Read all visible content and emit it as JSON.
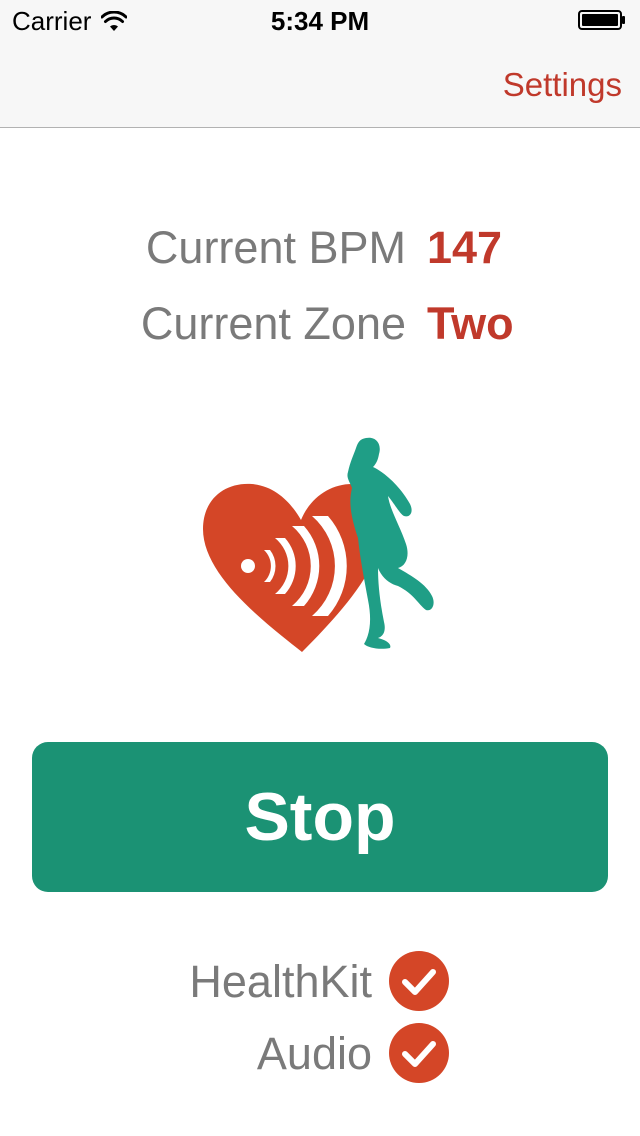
{
  "status_bar": {
    "carrier": "Carrier",
    "time": "5:34 PM",
    "wifi_icon": "wifi-icon",
    "battery_icon": "battery-icon"
  },
  "nav": {
    "settings_label": "Settings"
  },
  "stats": {
    "bpm_label": "Current BPM",
    "bpm_value": "147",
    "zone_label": "Current Zone",
    "zone_value": "Two"
  },
  "logo": {
    "icon": "heart-runner-logo"
  },
  "stop_button": {
    "label": "Stop"
  },
  "checks": [
    {
      "label": "HealthKit",
      "icon": "checkmark-icon",
      "checked": true
    },
    {
      "label": "Audio",
      "icon": "checkmark-icon",
      "checked": true
    }
  ],
  "colors": {
    "accent_red": "#c0392b",
    "heart_red": "#d44627",
    "runner_teal": "#1f9e86",
    "button_green": "#1b9274",
    "label_gray": "#7a7a7a"
  }
}
